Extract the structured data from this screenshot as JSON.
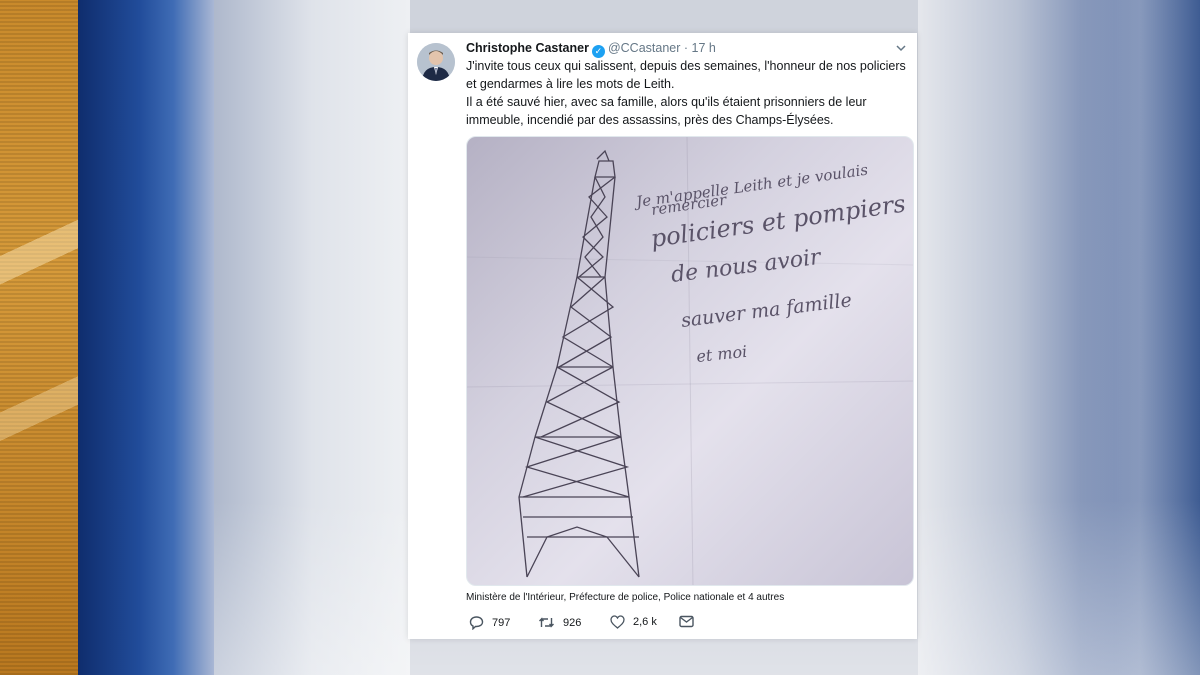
{
  "tweet": {
    "author_name": "Christophe Castaner",
    "handle": "@CCastaner",
    "separator": "·",
    "time": "17 h",
    "paragraph1": "J'invite tous ceux qui salissent, depuis des semaines, l'honneur de nos policiers et gendarmes à lire les mots de Leith.",
    "paragraph2": "Il a été sauvé hier, avec sa famille, alors qu'ils étaient prisonniers de leur immeuble, incendié par des assassins, près des Champs-Élysées.",
    "tagged": "Ministère de l'Intérieur, Préfecture de police, Police nationale et 4 autres",
    "stats": {
      "replies": "797",
      "retweets": "926",
      "likes": "2,6 k"
    }
  },
  "photo": {
    "handwriting_lines": [
      "Je m'appelle Leith et je voulais",
      "remercier",
      "policiers et pompiers",
      "de nous avoir",
      "sauver ma famille",
      "et moi"
    ]
  },
  "colors": {
    "verified": "#1da1f2",
    "gold": "#c98a2b",
    "brand_blue": "#214c9a"
  },
  "icons": [
    "verified-icon",
    "chevron-down-icon",
    "reply-icon",
    "retweet-icon",
    "like-icon",
    "message-icon"
  ]
}
